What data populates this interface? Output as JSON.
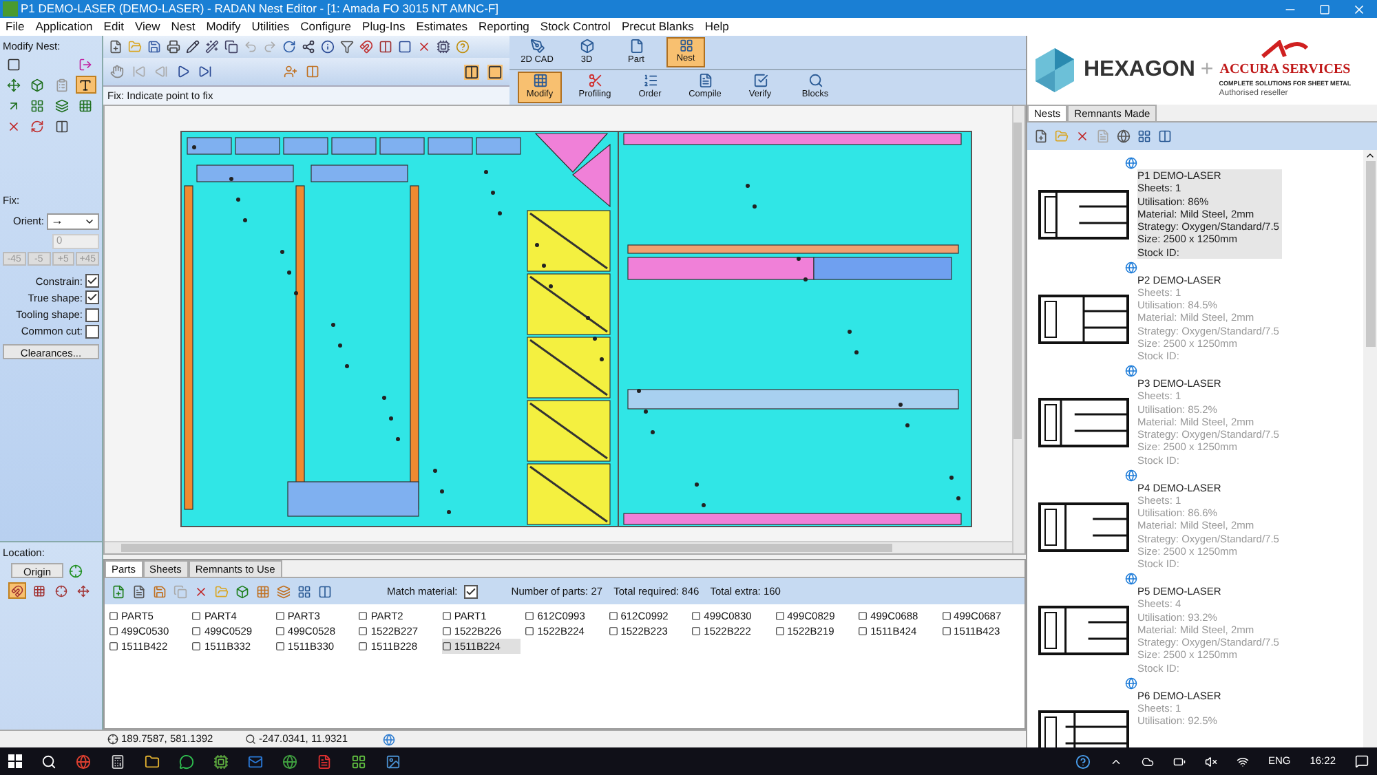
{
  "window": {
    "title": "P1 DEMO-LASER (DEMO-LASER) - RADAN Nest Editor - [1: Amada FO 3015 NT AMNC-F]"
  },
  "menu": [
    "File",
    "Application",
    "Edit",
    "View",
    "Nest",
    "Modify",
    "Utilities",
    "Configure",
    "Plug-Ins",
    "Estimates",
    "Reporting",
    "Stock Control",
    "Precut Blanks",
    "Help"
  ],
  "ribbon": {
    "top": [
      {
        "label": "2D CAD",
        "selected": false
      },
      {
        "label": "3D",
        "selected": false
      },
      {
        "label": "Part",
        "selected": false
      },
      {
        "label": "Nest",
        "selected": true
      }
    ],
    "bottom": [
      {
        "label": "Modify",
        "selected": true
      },
      {
        "label": "Profiling",
        "selected": false
      },
      {
        "label": "Order",
        "selected": false
      },
      {
        "label": "Compile",
        "selected": false
      },
      {
        "label": "Verify",
        "selected": false
      },
      {
        "label": "Blocks",
        "selected": false
      }
    ]
  },
  "prompt": "Fix: Indicate point to fix",
  "left_panel": {
    "modify_label": "Modify Nest:",
    "modify_tools": [
      {
        "selected": false
      },
      {
        "selected": false
      },
      {
        "selected": false
      },
      {
        "selected": false
      },
      {
        "selected": false
      },
      {
        "selected": true
      },
      {
        "selected": false
      },
      {
        "selected": false
      },
      {
        "selected": false
      },
      {
        "selected": false
      },
      {
        "selected": false
      },
      {
        "selected": false
      },
      {
        "selected": false
      }
    ],
    "fix_label": "Fix:",
    "orient_label": "Orient:",
    "orient_value": "→",
    "angle_value": "0",
    "angle_buttons": [
      {
        "label": "-45",
        "disabled": true
      },
      {
        "label": "-5",
        "disabled": true
      },
      {
        "label": "+5",
        "disabled": true
      },
      {
        "label": "+45",
        "disabled": true
      }
    ],
    "options": [
      {
        "label": "Constrain:",
        "checked": true
      },
      {
        "label": "True shape:",
        "checked": true
      },
      {
        "label": "Tooling shape:",
        "checked": false
      },
      {
        "label": "Common cut:",
        "checked": false
      }
    ],
    "clearances_button": "Clearances...",
    "location_label": "Location:",
    "origin_button": "Origin",
    "location_tools": [
      {
        "selected": true
      },
      {
        "selected": false
      },
      {
        "selected": false
      },
      {
        "selected": false
      }
    ]
  },
  "parts_panel": {
    "tabs": [
      {
        "label": "Parts",
        "selected": true
      },
      {
        "label": "Sheets",
        "selected": false
      },
      {
        "label": "Remnants to Use",
        "selected": false
      }
    ],
    "match_material": {
      "label": "Match material:",
      "checked": true
    },
    "counts": [
      "Number of parts: 27",
      "Total required: 846",
      "Total extra: 160"
    ],
    "parts": [
      {
        "name": "PART5",
        "selected": false
      },
      {
        "name": "PART4",
        "selected": false
      },
      {
        "name": "PART3",
        "selected": false
      },
      {
        "name": "PART2",
        "selected": false
      },
      {
        "name": "PART1",
        "selected": false
      },
      {
        "name": "612C0993",
        "selected": false
      },
      {
        "name": "612C0992",
        "selected": false
      },
      {
        "name": "499C0830",
        "selected": false
      },
      {
        "name": "499C0829",
        "selected": false
      },
      {
        "name": "499C0688",
        "selected": false
      },
      {
        "name": "499C0687",
        "selected": false
      },
      {
        "name": "499C0530",
        "selected": false
      },
      {
        "name": "499C0529",
        "selected": false
      },
      {
        "name": "499C0528",
        "selected": false
      },
      {
        "name": "1522B227",
        "selected": false
      },
      {
        "name": "1522B226",
        "selected": false
      },
      {
        "name": "1522B224",
        "selected": false
      },
      {
        "name": "1522B223",
        "selected": false
      },
      {
        "name": "1522B222",
        "selected": false
      },
      {
        "name": "1522B219",
        "selected": false
      },
      {
        "name": "1511B424",
        "selected": false
      },
      {
        "name": "1511B423",
        "selected": false
      },
      {
        "name": "1511B422",
        "selected": false
      },
      {
        "name": "1511B332",
        "selected": false
      },
      {
        "name": "1511B330",
        "selected": false
      },
      {
        "name": "1511B228",
        "selected": false
      },
      {
        "name": "1511B224",
        "selected": true
      }
    ]
  },
  "status_bar": [
    "189.7587, 581.1392",
    "-247.0341, 11.9321"
  ],
  "branding": {
    "logo": "HEXAGON",
    "plus": "+",
    "partner": "ACCURA SERVICES",
    "tagline": "COMPLETE SOLUTIONS FOR SHEET METAL",
    "note": "Authorised reseller"
  },
  "nests_panel": {
    "tabs": [
      {
        "label": "Nests",
        "selected": true
      },
      {
        "label": "Remnants Made",
        "selected": false
      }
    ],
    "items": [
      {
        "title": "P1 DEMO-LASER",
        "selected": true,
        "lines": [
          "Sheets: 1",
          "Utilisation: 86%",
          "Material: Mild Steel, 2mm",
          "Strategy: Oxygen/Standard/7.5",
          "Size: 2500 x 1250mm",
          "Stock ID:"
        ]
      },
      {
        "title": "P2 DEMO-LASER",
        "selected": false,
        "lines": [
          "Sheets: 1",
          "Utilisation: 84.5%",
          "Material: Mild Steel, 2mm",
          "Strategy: Oxygen/Standard/7.5",
          "Size: 2500 x 1250mm",
          "Stock ID:"
        ]
      },
      {
        "title": "P3 DEMO-LASER",
        "selected": false,
        "lines": [
          "Sheets: 1",
          "Utilisation: 85.2%",
          "Material: Mild Steel, 2mm",
          "Strategy: Oxygen/Standard/7.5",
          "Size: 2500 x 1250mm",
          "Stock ID:"
        ]
      },
      {
        "title": "P4 DEMO-LASER",
        "selected": false,
        "lines": [
          "Sheets: 1",
          "Utilisation: 86.6%",
          "Material: Mild Steel, 2mm",
          "Strategy: Oxygen/Standard/7.5",
          "Size: 2500 x 1250mm",
          "Stock ID:"
        ]
      },
      {
        "title": "P5 DEMO-LASER",
        "selected": false,
        "lines": [
          "Sheets: 4",
          "Utilisation: 93.2%",
          "Material: Mild Steel, 2mm",
          "Strategy: Oxygen/Standard/7.5",
          "Size: 2500 x 1250mm",
          "Stock ID:"
        ]
      },
      {
        "title": "P6 DEMO-LASER",
        "selected": false,
        "lines": [
          "Sheets: 1",
          "Utilisation: 92.5%"
        ]
      }
    ]
  },
  "taskbar": {
    "language": "ENG",
    "time": "16:22"
  }
}
